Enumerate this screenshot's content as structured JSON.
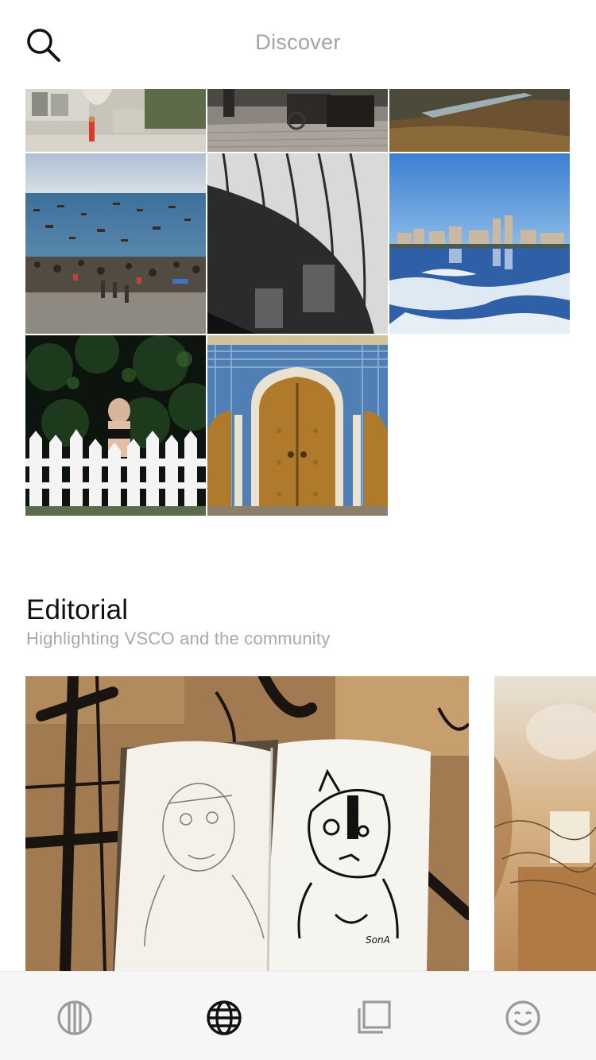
{
  "header": {
    "title": "Discover",
    "search_icon": "search-icon"
  },
  "grid": {
    "photos": [
      {
        "name": "photo-plaza-child",
        "subject": "plaza with child"
      },
      {
        "name": "photo-carriage-street",
        "subject": "horse carriage street"
      },
      {
        "name": "photo-hills-river",
        "subject": "hills and river"
      },
      {
        "name": "photo-beach-boats",
        "subject": "beach with boats"
      },
      {
        "name": "photo-building-curve",
        "subject": "curved glass building"
      },
      {
        "name": "photo-city-lake",
        "subject": "city skyline over icy lake"
      },
      {
        "name": "photo-fence-woman",
        "subject": "woman behind white fence"
      },
      {
        "name": "photo-ornate-door",
        "subject": "ornate arched doors"
      }
    ]
  },
  "editorial": {
    "title": "Editorial",
    "subtitle": "Highlighting VSCO and the community",
    "cards": [
      {
        "name": "editorial-sketchbook",
        "signature": "SonA"
      },
      {
        "name": "editorial-barbed-wire"
      }
    ]
  },
  "tabbar": {
    "tabs": [
      {
        "name": "tab-feed",
        "icon": "feed-icon",
        "active": false
      },
      {
        "name": "tab-discover",
        "icon": "globe-icon",
        "active": true
      },
      {
        "name": "tab-studio",
        "icon": "studio-icon",
        "active": false
      },
      {
        "name": "tab-profile",
        "icon": "smiley-icon",
        "active": false
      }
    ]
  },
  "colors": {
    "active_icon": "#111111",
    "inactive_icon": "#9a9a9a",
    "muted_text": "#a3a3a3"
  }
}
